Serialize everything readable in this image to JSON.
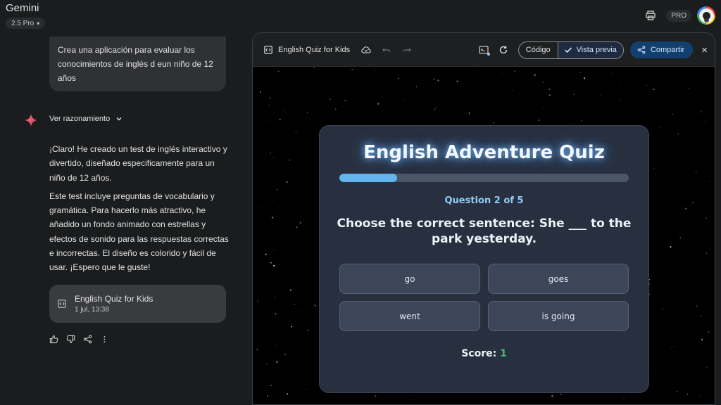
{
  "app": {
    "title": "Gemini",
    "model": "2.5 Pro",
    "plan_badge": "PRO"
  },
  "chat": {
    "user_prompt": "Crea una aplicación para evaluar los conocimientos de inglés d eun niño de 12 años",
    "reasoning_label": "Ver razonamiento",
    "reply_paragraphs": [
      "¡Claro! He creado un test de inglés interactivo y divertido, diseñado especificamente para un niño de 12 años.",
      "Este test incluye preguntas de vocabulario y gramática. Para hacerlo más atractivo, he añadido un fondo animado con estrellas y efectos de sonido para las respuestas correctas e incorrectas. El diseño es colorido y fácil de usar. ¡Espero que le guste!"
    ],
    "artifact": {
      "title": "English Quiz for Kids",
      "timestamp": "1 jul, 13:38"
    },
    "icons": [
      "thumb-up-icon",
      "thumb-down-icon",
      "share-icon",
      "more-vert-icon"
    ]
  },
  "canvas": {
    "title": "English Quiz for Kids",
    "code_tab": "Código",
    "preview_tab": "Vista previa",
    "share_label": "Compartir",
    "close_label": "×"
  },
  "quiz": {
    "title": "English Adventure Quiz",
    "progress_fraction": 0.2,
    "question_counter": "Question 2 of 5",
    "question": "Choose the correct sentence: She ___ to the park yesterday.",
    "options": [
      "go",
      "goes",
      "went",
      "is going"
    ],
    "score_label": "Score:",
    "score_value": "1"
  },
  "colors": {
    "accent_blue": "#63b3ed",
    "score_green": "#48bb78",
    "preview_tab": "#1e2b3f"
  }
}
